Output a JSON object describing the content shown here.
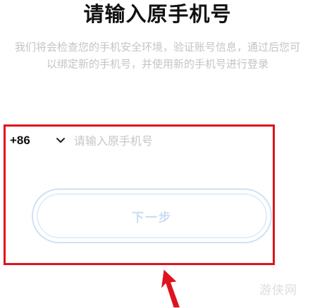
{
  "title": "请输入原手机号",
  "description": "我们将会检查您的手机安全环境，验证账号信息，通过后您可以绑定新的手机号，并使用新的手机号进行登录",
  "phone": {
    "country_code": "+86",
    "dropdown_icon": "chevron-down-icon",
    "placeholder": "请输入原手机号",
    "value": ""
  },
  "next_button": {
    "label": "下一步",
    "state": "disabled"
  },
  "annotation": {
    "highlight_color": "#e0121d",
    "arrow_icon": "red-arrow-icon"
  },
  "watermark": "游侠网"
}
